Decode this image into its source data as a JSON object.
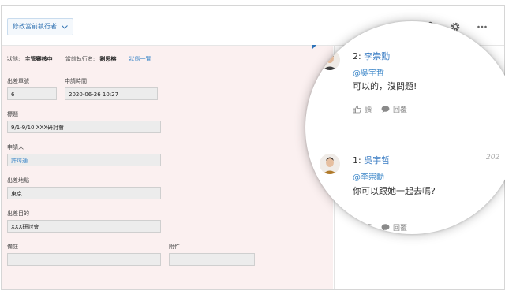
{
  "toolbar": {
    "modify_label": "修改當前執行者",
    "icons": [
      "attachment-icon",
      "gear-icon",
      "more-icon"
    ]
  },
  "status": {
    "status_label": "狀態:",
    "status_value": "主管審核中",
    "executor_label": "當前執行者:",
    "executor_value": "劉思榕",
    "history_link": "狀態一覽"
  },
  "form": {
    "trip_no_label": "出差單號",
    "trip_no_value": "6",
    "apply_time_label": "申請時間",
    "apply_time_value": "2020-06-26 10:27",
    "title_label": "標題",
    "title_value": "9/1-9/10 XXX研討會",
    "applicant_label": "申請人",
    "applicant_value": "許煒通",
    "location_label": "出差地點",
    "location_value": "東京",
    "purpose_label": "出差目的",
    "purpose_value": "XXX研討會",
    "remark_label": "備註",
    "remark_value": "",
    "attachment_label": "附件",
    "attachment_value": ""
  },
  "comments": [
    {
      "number": "2:",
      "author": "李崇勳",
      "mention": "@吳宇哲",
      "text": "可以的，沒問題!",
      "read_label": "讀",
      "reply_label": "回覆",
      "date": ""
    },
    {
      "number": "1:",
      "author": "吳宇哲",
      "mention": "@李崇勳",
      "text": "你可以跟她一起去嗎?",
      "read_label": "讀",
      "reply_label": "回覆",
      "date": "202"
    }
  ]
}
